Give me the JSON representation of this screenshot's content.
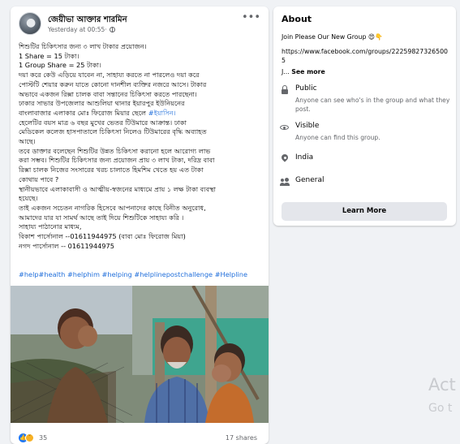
{
  "post": {
    "author": "জেয়ীভা আক্তার শারমিন",
    "timestamp": "Yesterday at 00:55",
    "visibility_icon": "globe-icon",
    "menu_icon": "more-options-icon",
    "lines": [
      "শিশুটির চিকিৎসার জন্য ৩ লাখ টাকার প্রয়োজন।",
      "1 Share = 15 টাকা।",
      "1 Group Share = 25 টাকা।",
      "দয়া করে কেউ এড়িয়ে যাবেন না, সাহায্য করতে না পারলেও দয়া করে",
      "পোস্টটি শেয়ার করুন যাতে কোনো দানশীল ব্যক্তির নজরে আসে। টাকার",
      "অভাবে একজন রিক্সা চালক বাবা সন্তানের চিকিৎসা করতে পারছেনা।",
      "ঢাকার সাভার উপজেলার আশুলিয়া থানার ইয়ারপুর ইউনিয়নের",
      "বাংলাবাজার এলাকার মোঃ ফিরোজ মিয়ার ছেলে",
      "হেলেটির বয়স মাত্র ৬ বছর মুখের ভেতর টিউমারে আক্রান্ত। ঢাকা",
      "মেডিকেল কলেজ হাসপাতালে চিকিৎসা নিলেও টিউমারের বৃদ্ধি অব্যাহত",
      "আছে।",
      "তবে ডাক্তার বলেছেন শিশুটির উন্নত চিকিৎসা করানো হলে আরোগ্য লাভ",
      "করা সম্ভব। শিশুটির চিকিৎসার জন্য প্রয়োজন প্রায় ৩ লাখ টাকা, দরিদ্র বাবা",
      "রিক্সা চালক নিজের সংসারের খরচ চালাতে হিমশিম খেতে হয় এত টাকা",
      "কোথায় পাবে ?",
      "স্থানীয়ভাবে এলাকাবাসী ও আত্মীয়-স্বজনের মাধ্যমে প্রায় ১ লক্ষ টাকা ব্যবস্থা",
      "হয়েছে।",
      "তাই একজন সচেতন নাগরিক হিসেবে আপনাদের কাছে বিনীত অনুরোধ,",
      "আমাদের যার যা সামর্থ আছে তাই দিয়ে শিশুটিকে সাহায্য করি ।",
      "সাহায্য পাঠানোর মাধ্যম,",
      "বিকাশ পার্সোনাল --01611944975 (বাবা মোঃ ফিরোজ মিয়া)",
      "নগদ পার্সোনাল -- 01611944975"
    ],
    "son_name": "#ইয়াসিন।",
    "hashtags": "#help#health #helphim #helping #helplinepostchallenge #Helpline",
    "reaction_count": "35",
    "shares": "17 shares"
  },
  "about": {
    "title": "About",
    "description": "Join Please Our New Group 😍👇",
    "url": "https://www.facebook.com/groups/222598273265005",
    "ellipsis": "J...",
    "see_more": "See more",
    "items": [
      {
        "icon": "lock-icon",
        "title": "Public",
        "desc": "Anyone can see who's in the group and what they post."
      },
      {
        "icon": "eye-icon",
        "title": "Visible",
        "desc": "Anyone can find this group."
      },
      {
        "icon": "location-pin-icon",
        "title": "India",
        "desc": ""
      },
      {
        "icon": "people-icon",
        "title": "General",
        "desc": ""
      }
    ],
    "button_label": "Learn More"
  },
  "watermark": {
    "line1": "Act",
    "line2": "Go t"
  },
  "colors": {
    "page_bg": "#f0f2f5",
    "link": "#216fdb",
    "muted": "#65676b",
    "button_bg": "#e4e6eb"
  }
}
